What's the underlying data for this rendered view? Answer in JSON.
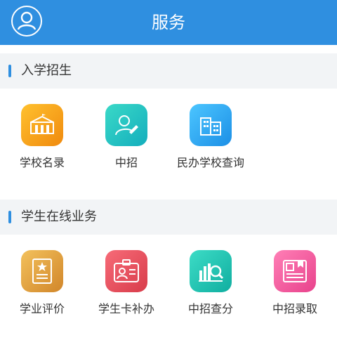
{
  "header": {
    "title": "服务"
  },
  "sections": [
    {
      "title": "入学招生",
      "items": [
        {
          "label": "学校名录",
          "icon": "school-building-icon",
          "color": "#f7a21a"
        },
        {
          "label": "中招",
          "icon": "person-edit-icon",
          "color": "#20c0b8"
        },
        {
          "label": "民办学校查询",
          "icon": "office-building-icon",
          "color": "#2aa8ee"
        }
      ]
    },
    {
      "title": "学生在线业务",
      "items": [
        {
          "label": "学业评价",
          "icon": "certificate-icon",
          "color": "#e0a640"
        },
        {
          "label": "学生卡补办",
          "icon": "id-card-icon",
          "color": "#e8505a"
        },
        {
          "label": "中招查分",
          "icon": "chart-search-icon",
          "color": "#1fc4b0"
        },
        {
          "label": "中招录取",
          "icon": "admission-letter-icon",
          "color": "#f0549c"
        }
      ]
    }
  ]
}
